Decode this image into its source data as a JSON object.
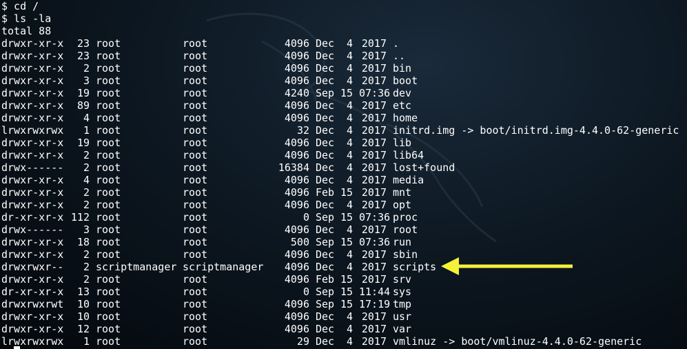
{
  "terminal": {
    "commands": [
      "$ cd /",
      "$ ls -la"
    ],
    "total": "total 88",
    "entries": [
      {
        "perm": "drwxr-xr-x",
        "links": "23",
        "user": "root",
        "group": "root",
        "size": "4096",
        "month": "Dec",
        "day": "4",
        "time": "2017",
        "name": "."
      },
      {
        "perm": "drwxr-xr-x",
        "links": "23",
        "user": "root",
        "group": "root",
        "size": "4096",
        "month": "Dec",
        "day": "4",
        "time": "2017",
        "name": ".."
      },
      {
        "perm": "drwxr-xr-x",
        "links": "2",
        "user": "root",
        "group": "root",
        "size": "4096",
        "month": "Dec",
        "day": "4",
        "time": "2017",
        "name": "bin"
      },
      {
        "perm": "drwxr-xr-x",
        "links": "3",
        "user": "root",
        "group": "root",
        "size": "4096",
        "month": "Dec",
        "day": "4",
        "time": "2017",
        "name": "boot"
      },
      {
        "perm": "drwxr-xr-x",
        "links": "19",
        "user": "root",
        "group": "root",
        "size": "4240",
        "month": "Sep",
        "day": "15",
        "time": "07:36",
        "name": "dev"
      },
      {
        "perm": "drwxr-xr-x",
        "links": "89",
        "user": "root",
        "group": "root",
        "size": "4096",
        "month": "Dec",
        "day": "4",
        "time": "2017",
        "name": "etc"
      },
      {
        "perm": "drwxr-xr-x",
        "links": "4",
        "user": "root",
        "group": "root",
        "size": "4096",
        "month": "Dec",
        "day": "4",
        "time": "2017",
        "name": "home"
      },
      {
        "perm": "lrwxrwxrwx",
        "links": "1",
        "user": "root",
        "group": "root",
        "size": "32",
        "month": "Dec",
        "day": "4",
        "time": "2017",
        "name": "initrd.img -> boot/initrd.img-4.4.0-62-generic"
      },
      {
        "perm": "drwxr-xr-x",
        "links": "19",
        "user": "root",
        "group": "root",
        "size": "4096",
        "month": "Dec",
        "day": "4",
        "time": "2017",
        "name": "lib"
      },
      {
        "perm": "drwxr-xr-x",
        "links": "2",
        "user": "root",
        "group": "root",
        "size": "4096",
        "month": "Dec",
        "day": "4",
        "time": "2017",
        "name": "lib64"
      },
      {
        "perm": "drwx------",
        "links": "2",
        "user": "root",
        "group": "root",
        "size": "16384",
        "month": "Dec",
        "day": "4",
        "time": "2017",
        "name": "lost+found"
      },
      {
        "perm": "drwxr-xr-x",
        "links": "4",
        "user": "root",
        "group": "root",
        "size": "4096",
        "month": "Dec",
        "day": "4",
        "time": "2017",
        "name": "media"
      },
      {
        "perm": "drwxr-xr-x",
        "links": "2",
        "user": "root",
        "group": "root",
        "size": "4096",
        "month": "Feb",
        "day": "15",
        "time": "2017",
        "name": "mnt"
      },
      {
        "perm": "drwxr-xr-x",
        "links": "2",
        "user": "root",
        "group": "root",
        "size": "4096",
        "month": "Dec",
        "day": "4",
        "time": "2017",
        "name": "opt"
      },
      {
        "perm": "dr-xr-xr-x",
        "links": "112",
        "user": "root",
        "group": "root",
        "size": "0",
        "month": "Sep",
        "day": "15",
        "time": "07:36",
        "name": "proc"
      },
      {
        "perm": "drwx------",
        "links": "3",
        "user": "root",
        "group": "root",
        "size": "4096",
        "month": "Dec",
        "day": "4",
        "time": "2017",
        "name": "root"
      },
      {
        "perm": "drwxr-xr-x",
        "links": "18",
        "user": "root",
        "group": "root",
        "size": "500",
        "month": "Sep",
        "day": "15",
        "time": "07:36",
        "name": "run"
      },
      {
        "perm": "drwxr-xr-x",
        "links": "2",
        "user": "root",
        "group": "root",
        "size": "4096",
        "month": "Dec",
        "day": "4",
        "time": "2017",
        "name": "sbin"
      },
      {
        "perm": "drwxrwxr--",
        "links": "2",
        "user": "scriptmanager",
        "group": "scriptmanager",
        "size": "4096",
        "month": "Dec",
        "day": "4",
        "time": "2017",
        "name": "scripts"
      },
      {
        "perm": "drwxr-xr-x",
        "links": "2",
        "user": "root",
        "group": "root",
        "size": "4096",
        "month": "Feb",
        "day": "15",
        "time": "2017",
        "name": "srv"
      },
      {
        "perm": "dr-xr-xr-x",
        "links": "13",
        "user": "root",
        "group": "root",
        "size": "0",
        "month": "Sep",
        "day": "15",
        "time": "11:44",
        "name": "sys"
      },
      {
        "perm": "drwxrwxrwt",
        "links": "10",
        "user": "root",
        "group": "root",
        "size": "4096",
        "month": "Sep",
        "day": "15",
        "time": "17:19",
        "name": "tmp"
      },
      {
        "perm": "drwxr-xr-x",
        "links": "10",
        "user": "root",
        "group": "root",
        "size": "4096",
        "month": "Dec",
        "day": "4",
        "time": "2017",
        "name": "usr"
      },
      {
        "perm": "drwxr-xr-x",
        "links": "12",
        "user": "root",
        "group": "root",
        "size": "4096",
        "month": "Dec",
        "day": "4",
        "time": "2017",
        "name": "var"
      },
      {
        "perm": "lrwxrwxrwx",
        "links": "1",
        "user": "root",
        "group": "root",
        "size": "29",
        "month": "Dec",
        "day": "4",
        "time": "2017",
        "name": "vmlinuz -> boot/vmlinuz-4.4.0-62-generic"
      }
    ]
  },
  "annotation": {
    "arrow_color": "#f5f03a",
    "points_to": "scripts"
  },
  "colors": {
    "text": "#ffffff",
    "background": "#0a1520"
  }
}
